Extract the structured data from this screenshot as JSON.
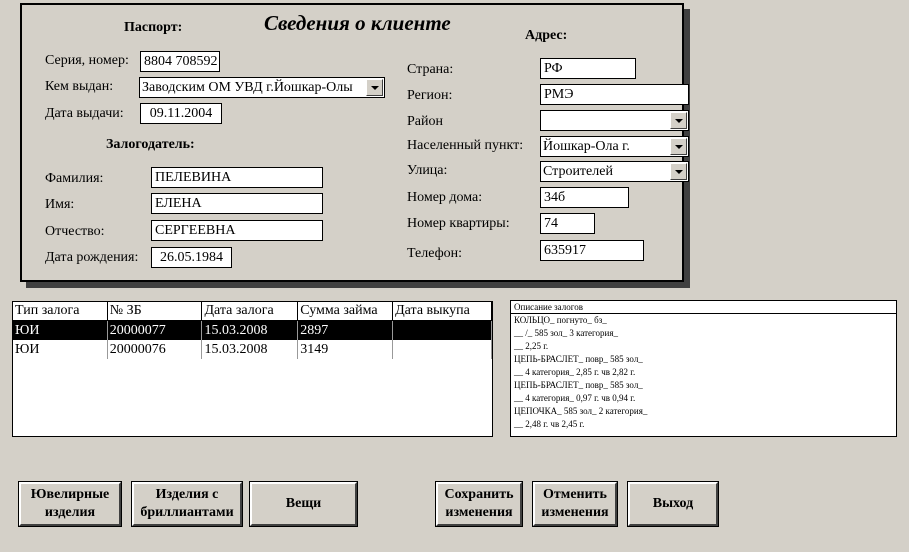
{
  "form": {
    "title": "Сведения о клиенте",
    "passport": {
      "section": "Паспорт:",
      "series_label": "Серия, номер:",
      "series_value": "8804 708592",
      "issued_by_label": "Кем выдан:",
      "issued_by_value": "Заводским ОМ УВД г.Йошкар-Олы",
      "issue_date_label": "Дата выдачи:",
      "issue_date_value": "09.11.2004"
    },
    "pledger": {
      "section": "Залогодатель:",
      "surname_label": "Фамилия:",
      "surname_value": "ПЕЛЕВИНА",
      "name_label": "Имя:",
      "name_value": "ЕЛЕНА",
      "patronymic_label": "Отчество:",
      "patronymic_value": "СЕРГЕЕВНА",
      "birth_label": "Дата рождения:",
      "birth_value": "26.05.1984"
    },
    "address": {
      "section": "Адрес:",
      "country_label": "Страна:",
      "country_value": "РФ",
      "region_label": "Регион:",
      "region_value": "РМЭ",
      "district_label": "Район",
      "district_value": "",
      "locality_label": "Населенный пункт:",
      "locality_value": "Йошкар-Ола г.",
      "street_label": "Улица:",
      "street_value": "Строителей",
      "house_label": "Номер дома:",
      "house_value": "34б",
      "apartment_label": "Номер квартиры:",
      "apartment_value": "74",
      "phone_label": "Телефон:",
      "phone_value": "635917"
    }
  },
  "pledges": {
    "columns": [
      "Тип залога",
      "№ ЗБ",
      "Дата залога",
      "Сумма займа",
      "Дата выкупа"
    ],
    "rows": [
      [
        "ЮИ",
        "20000077",
        "15.03.2008",
        "2897",
        ""
      ],
      [
        "ЮИ",
        "20000076",
        "15.03.2008",
        "3149",
        ""
      ]
    ]
  },
  "description": {
    "header": "Описание залогов",
    "lines": [
      "КОЛЬЦО_ погнуто_ бз_",
      "__ /_ 585 зол_ 3 категория_",
      "__ 2,25 г.",
      "ЦЕПЬ-БРАСЛЕТ_ повр_ 585 зол_",
      "__ 4 категория_ 2,85 г. чв 2,82 г.",
      "ЦЕПЬ-БРАСЛЕТ_ повр_ 585 зол_",
      "__ 4 категория_ 0,97 г. чв 0,94 г.",
      "ЦЕПОЧКА_ 585 зол_ 2 категория_",
      "__ 2,48 г. чв 2,45 г."
    ]
  },
  "buttons": {
    "jewelry_l1": "Ювелирные",
    "jewelry_l2": "изделия",
    "diamonds_l1": "Изделия с",
    "diamonds_l2": "бриллиантами",
    "things": "Вещи",
    "save_l1": "Сохранить",
    "save_l2": "изменения",
    "cancel_l1": "Отменить",
    "cancel_l2": "изменения",
    "exit": "Выход"
  }
}
